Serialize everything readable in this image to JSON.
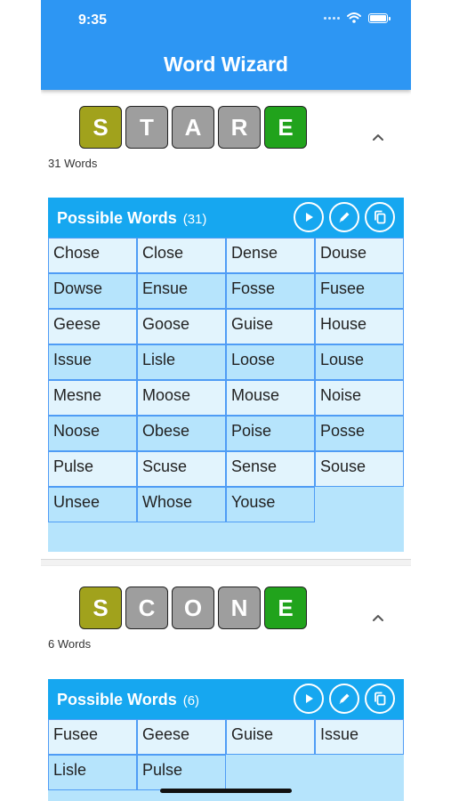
{
  "status_bar": {
    "time": "9:35"
  },
  "header": {
    "title": "Word Wizard"
  },
  "guesses": [
    {
      "tiles": [
        {
          "letter": "S",
          "state": "present"
        },
        {
          "letter": "T",
          "state": "absent"
        },
        {
          "letter": "A",
          "state": "absent"
        },
        {
          "letter": "R",
          "state": "absent"
        },
        {
          "letter": "E",
          "state": "correct"
        }
      ],
      "word_count_label": "31 Words",
      "panel": {
        "title": "Possible Words",
        "count": "(31)",
        "words": [
          "Chose",
          "Close",
          "Dense",
          "Douse",
          "Dowse",
          "Ensue",
          "Fosse",
          "Fusee",
          "Geese",
          "Goose",
          "Guise",
          "House",
          "Issue",
          "Lisle",
          "Loose",
          "Louse",
          "Mesne",
          "Moose",
          "Mouse",
          "Noise",
          "Noose",
          "Obese",
          "Poise",
          "Posse",
          "Pulse",
          "Scuse",
          "Sense",
          "Souse",
          "Unsee",
          "Whose",
          "Youse"
        ]
      }
    },
    {
      "tiles": [
        {
          "letter": "S",
          "state": "present"
        },
        {
          "letter": "C",
          "state": "absent"
        },
        {
          "letter": "O",
          "state": "absent"
        },
        {
          "letter": "N",
          "state": "absent"
        },
        {
          "letter": "E",
          "state": "correct"
        }
      ],
      "word_count_label": "6 Words",
      "panel": {
        "title": "Possible Words",
        "count": "(6)",
        "words": [
          "Fusee",
          "Geese",
          "Guise",
          "Issue",
          "Lisle",
          "Pulse"
        ]
      }
    }
  ],
  "icons": {
    "collapse": "chevron-up-icon",
    "play": "play-icon",
    "edit": "pencil-icon",
    "copy": "copy-icon",
    "wifi": "wifi-icon",
    "battery": "battery-icon"
  },
  "colors": {
    "header": "#2d96f3",
    "panel_header": "#16a7f0",
    "tile_present": "#a1a21c",
    "tile_absent": "#9e9e9e",
    "tile_correct": "#21a31c"
  }
}
